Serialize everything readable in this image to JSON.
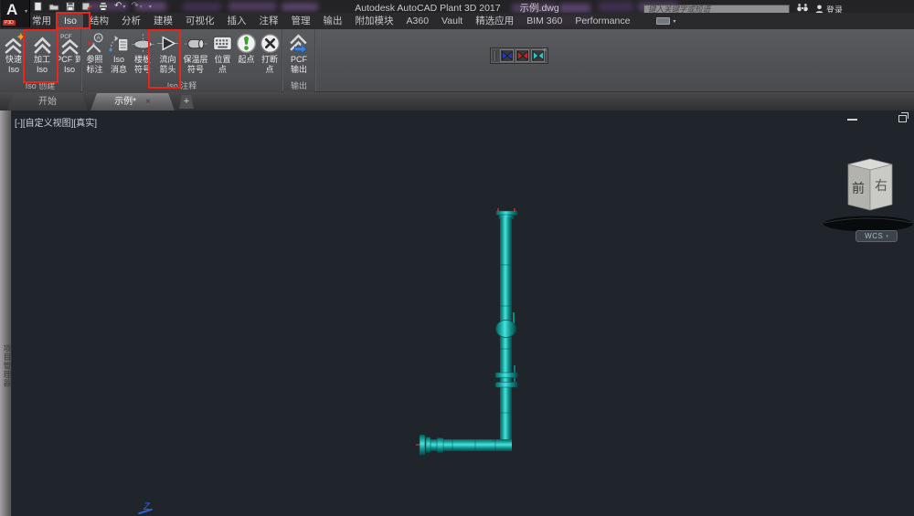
{
  "titlebar": {
    "logo_letter": "A",
    "logo_sub": "P3D",
    "app_title": "Autodesk AutoCAD Plant 3D 2017",
    "doc_name": "示例.dwg",
    "search_placeholder": "键入关键字或短语",
    "signin_label": "登录",
    "undo_glyph": "↶",
    "redo_glyph": "↷",
    "caret_glyph": "▾"
  },
  "quick_access_icons": [
    "new-file-icon",
    "open-file-icon",
    "save-icon",
    "save-as-icon",
    "plot-icon",
    "undo-icon",
    "redo-icon",
    "qat-dropdown-icon"
  ],
  "tabs": [
    {
      "label": "常用"
    },
    {
      "label": "Iso"
    },
    {
      "label": "结构"
    },
    {
      "label": "分析"
    },
    {
      "label": "建模"
    },
    {
      "label": "可视化"
    },
    {
      "label": "插入"
    },
    {
      "label": "注释"
    },
    {
      "label": "管理"
    },
    {
      "label": "输出"
    },
    {
      "label": "附加模块"
    },
    {
      "label": "A360"
    },
    {
      "label": "Vault"
    },
    {
      "label": "精选应用"
    },
    {
      "label": "BIM 360"
    },
    {
      "label": "Performance"
    }
  ],
  "active_tab": "Iso",
  "ribbon": {
    "pcf_icon_text": "PCF",
    "panels": [
      {
        "label": "Iso 创建",
        "buttons": [
          {
            "line1": "快速",
            "line2": "Iso"
          },
          {
            "line1": "加工",
            "line2": "Iso"
          },
          {
            "line1": "PCF 到",
            "line2": "Iso"
          }
        ]
      },
      {
        "label": "Iso 注释",
        "buttons": [
          {
            "line1": "参照",
            "line2": "标注"
          },
          {
            "line1": "Iso",
            "line2": "消息"
          },
          {
            "line1": "楼板",
            "line2": "符号"
          },
          {
            "line1": "流向",
            "line2": "箭头"
          },
          {
            "line1": "保温层",
            "line2": "符号"
          },
          {
            "line1": "位置",
            "line2": "点"
          },
          {
            "line1": "起点",
            "line2": ""
          },
          {
            "line1": "打断",
            "line2": "点"
          }
        ]
      },
      {
        "label": "输出",
        "buttons": [
          {
            "line1": "PCF",
            "line2": "输出"
          }
        ]
      }
    ]
  },
  "mini_toolbar": {
    "valve_colors": [
      "#2438c8",
      "#c82424",
      "#24c8c4"
    ],
    "close_glyph": "×"
  },
  "file_tabs": {
    "start_label": "开始",
    "active_label": "示例*",
    "close_glyph": "×",
    "add_glyph": "+"
  },
  "canvas": {
    "viewport_label": "[-][自定义视图][真实]",
    "palette_title": "项目管理器",
    "wcs_label": "WCS",
    "cube_front_label": "前",
    "cube_right_label": "右",
    "ucs_axis_label": "Z",
    "bg_color": "#1f252b",
    "pipe_color": "#2bd0ca"
  },
  "annotations": {
    "highlight_color": "#e8261f"
  }
}
